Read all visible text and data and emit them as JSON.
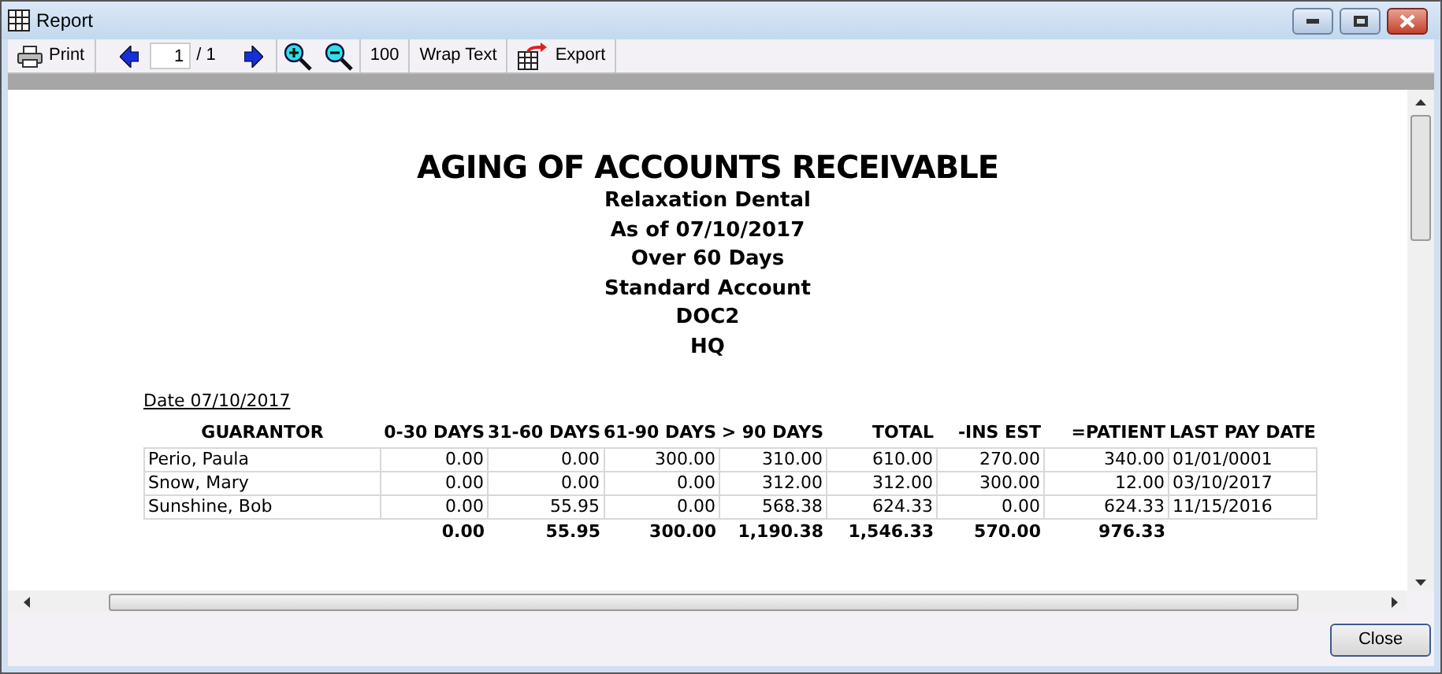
{
  "window": {
    "title": "Report"
  },
  "toolbar": [
    {
      "kind": "print",
      "label": "Print"
    },
    {
      "kind": "prev"
    },
    {
      "kind": "page",
      "value": "1",
      "total": "/ 1"
    },
    {
      "kind": "next"
    },
    {
      "kind": "zoom_in"
    },
    {
      "kind": "zoom_out"
    },
    {
      "kind": "text",
      "label": "100"
    },
    {
      "kind": "text",
      "label": "Wrap Text"
    },
    {
      "kind": "export",
      "label": "Export"
    }
  ],
  "report": {
    "title": "AGING OF ACCOUNTS RECEIVABLE",
    "subtitles": [
      "Relaxation Dental",
      "As of 07/10/2017",
      "Over 60 Days",
      "Standard Account",
      "DOC2",
      "HQ"
    ],
    "date_label": "Date 07/10/2017",
    "columns": [
      "GUARANTOR",
      "0-30 DAYS",
      "31-60 DAYS",
      "61-90 DAYS",
      "> 90 DAYS",
      "TOTAL",
      "-INS EST",
      "=PATIENT",
      "LAST PAY DATE"
    ],
    "rows": [
      [
        "Perio, Paula",
        "0.00",
        "0.00",
        "300.00",
        "310.00",
        "610.00",
        "270.00",
        "340.00",
        "01/01/0001"
      ],
      [
        "Snow, Mary",
        "0.00",
        "0.00",
        "0.00",
        "312.00",
        "312.00",
        "300.00",
        "12.00",
        "03/10/2017"
      ],
      [
        "Sunshine, Bob",
        "0.00",
        "55.95",
        "0.00",
        "568.38",
        "624.33",
        "0.00",
        "624.33",
        "11/15/2016"
      ]
    ],
    "totals": [
      "0.00",
      "55.95",
      "300.00",
      "1,190.38",
      "1,546.33",
      "570.00",
      "976.33"
    ]
  },
  "close_button": "Close"
}
